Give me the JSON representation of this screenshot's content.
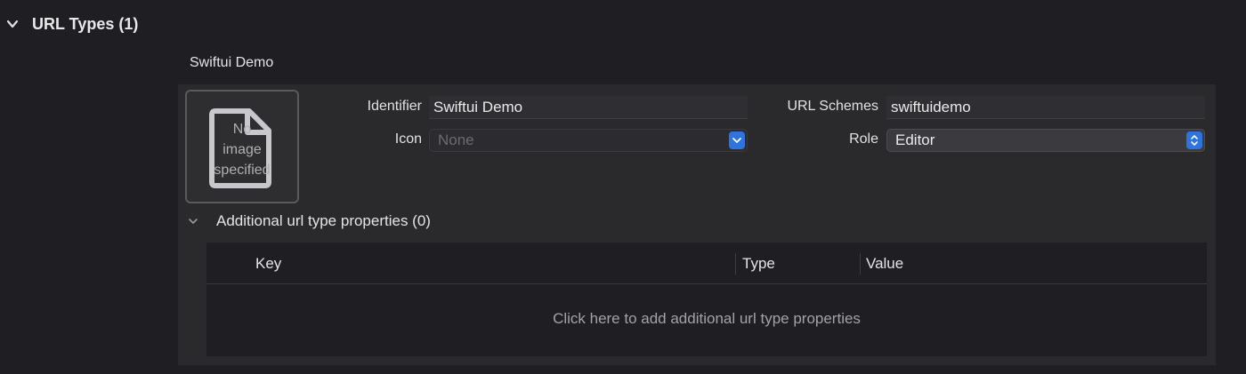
{
  "section": {
    "title": "URL Types (1)",
    "expanded": true
  },
  "item": {
    "name": "Swiftui Demo",
    "image_well": {
      "placeholder": "No\nimage\nspecified",
      "icon": "document-icon"
    },
    "fields": {
      "identifier": {
        "label": "Identifier",
        "value": "Swiftui Demo"
      },
      "icon": {
        "label": "Icon",
        "value": "None"
      },
      "url_schemes": {
        "label": "URL Schemes",
        "value": "swiftuidemo"
      },
      "role": {
        "label": "Role",
        "value": "Editor"
      }
    },
    "additional": {
      "title": "Additional url type properties (0)",
      "columns": [
        "Key",
        "Type",
        "Value"
      ],
      "empty_message": "Click here to add additional url type properties"
    }
  },
  "colors": {
    "accent": "#2f73de",
    "background": "#1f1f23",
    "panel": "#2a2a2c"
  }
}
